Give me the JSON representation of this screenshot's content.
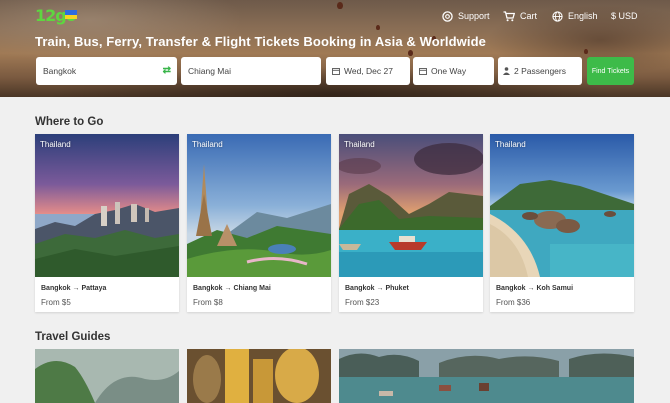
{
  "header": {
    "logo": "12go",
    "nav": {
      "support": "Support",
      "cart": "Cart",
      "language": "English",
      "currency": "$ USD"
    },
    "title": "Train, Bus, Ferry, Transfer & Flight Tickets Booking in Asia & Worldwide"
  },
  "search": {
    "from": "Bangkok",
    "to": "Chiang Mai",
    "date": "Wed, Dec 27",
    "trip_type": "One Way",
    "passengers": "2 Passengers",
    "find_button": "Find Tickets"
  },
  "where_to_go": {
    "title": "Where to Go",
    "cards": [
      {
        "country": "Thailand",
        "route": "Bangkok → Pattaya",
        "price": "From $5"
      },
      {
        "country": "Thailand",
        "route": "Bangkok → Chiang Mai",
        "price": "From $8"
      },
      {
        "country": "Thailand",
        "route": "Bangkok → Phuket",
        "price": "From $23"
      },
      {
        "country": "Thailand",
        "route": "Bangkok → Koh Samui",
        "price": "From $36"
      }
    ]
  },
  "travel_guides": {
    "title": "Travel Guides"
  },
  "colors": {
    "accent": "#3dbb49",
    "logo": "#5ed640"
  }
}
